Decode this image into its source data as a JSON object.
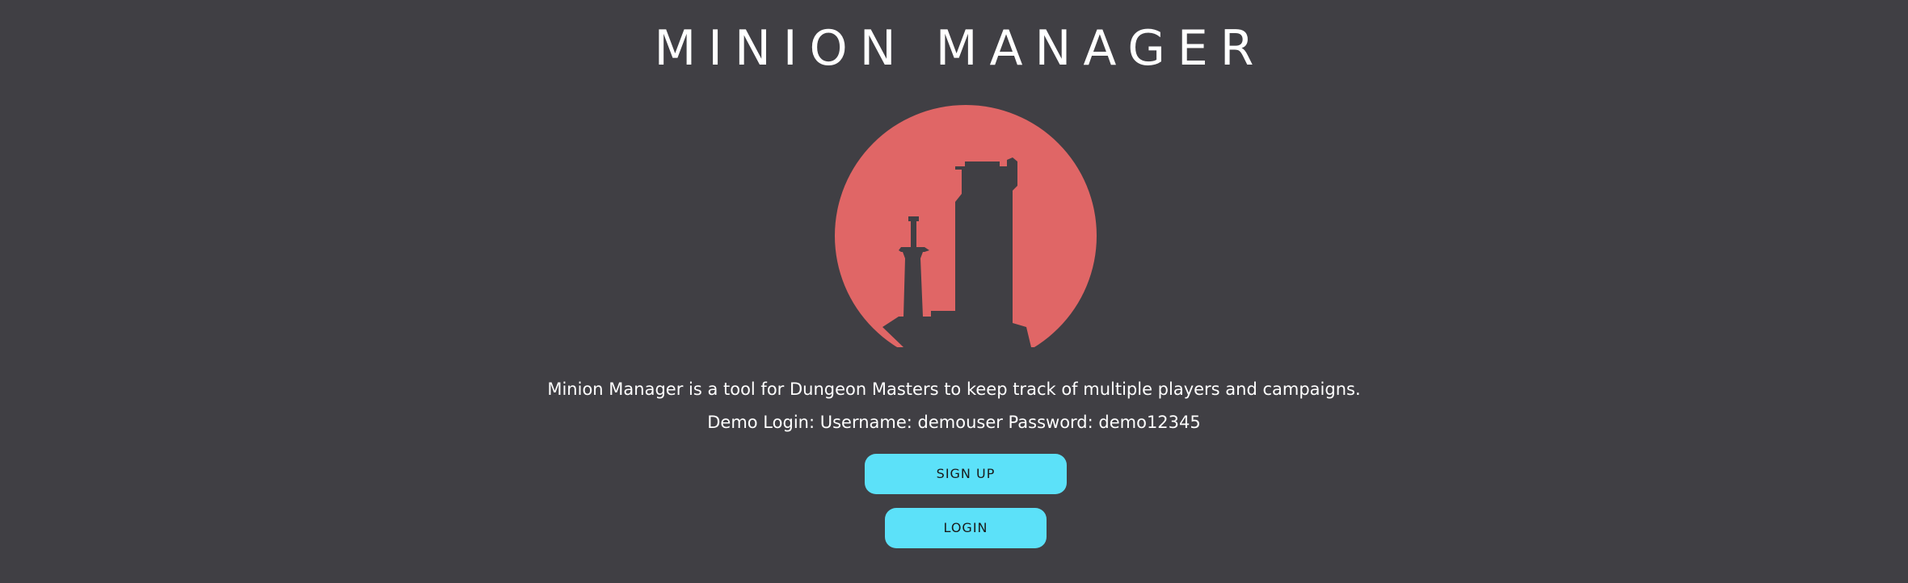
{
  "header": {
    "title": "MINION MANAGER"
  },
  "logo": {
    "icon": "castle-tower-sword-icon",
    "circle_color": "#e06666",
    "silhouette_color": "#403f44"
  },
  "intro": {
    "tagline": "Minion Manager is a tool for Dungeon Masters to keep track of multiple players and campaigns.",
    "demo_login": "Demo Login: Username: demouser Password: demo12345"
  },
  "actions": {
    "signup_label": "SIGN UP",
    "login_label": "LOGIN"
  },
  "colors": {
    "background": "#403f44",
    "button": "#5ce1f9",
    "text": "#ffffff"
  }
}
